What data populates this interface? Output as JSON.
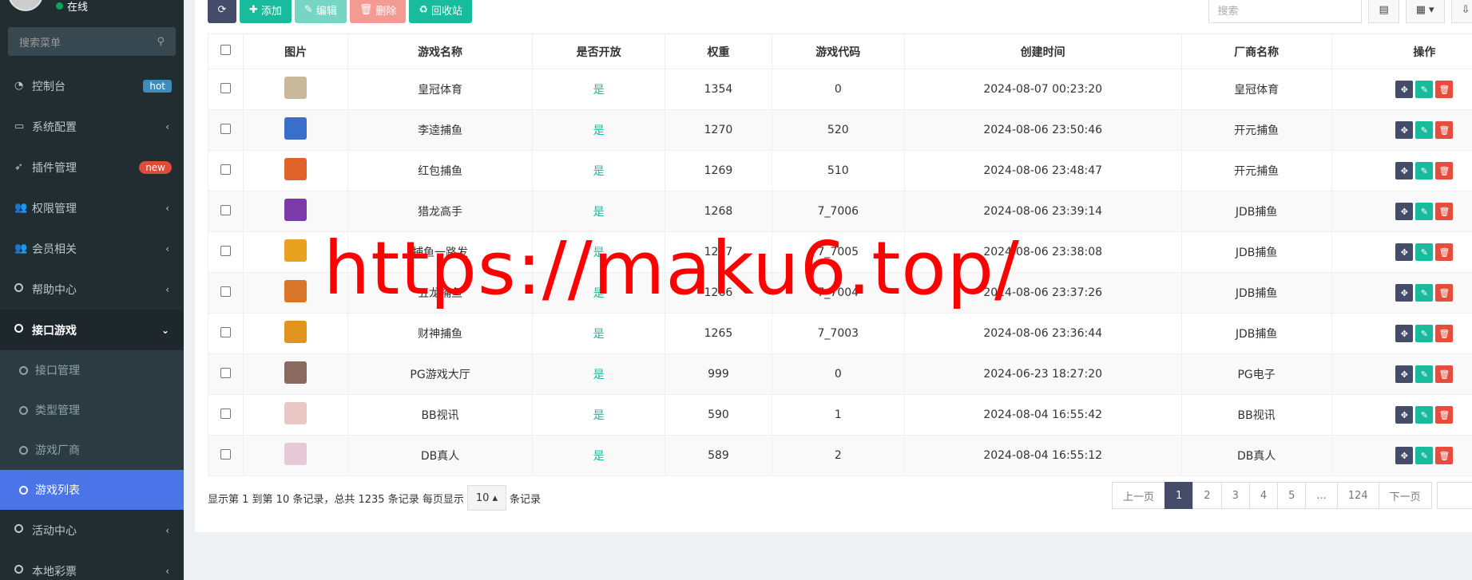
{
  "sidebar": {
    "user_status": "在线",
    "search_placeholder": "搜索菜单",
    "items": [
      {
        "label": "控制台",
        "badge": "hot"
      },
      {
        "label": "系统配置"
      },
      {
        "label": "插件管理",
        "badge": "new"
      },
      {
        "label": "权限管理"
      },
      {
        "label": "会员相关"
      },
      {
        "label": "帮助中心"
      },
      {
        "label": "接口游戏"
      },
      {
        "label": "活动中心"
      },
      {
        "label": "本地彩票"
      }
    ],
    "sub_items": [
      {
        "label": "接口管理"
      },
      {
        "label": "类型管理"
      },
      {
        "label": "游戏厂商"
      },
      {
        "label": "游戏列表"
      }
    ]
  },
  "toolbar": {
    "add": "添加",
    "edit": "编辑",
    "delete": "删除",
    "recycle": "回收站",
    "search_placeholder": "搜索"
  },
  "table": {
    "headers": [
      "图片",
      "游戏名称",
      "是否开放",
      "权重",
      "游戏代码",
      "创建时间",
      "厂商名称",
      "操作"
    ],
    "rows": [
      {
        "name": "皇冠体育",
        "open": "是",
        "weight": "1354",
        "code": "0",
        "created": "2024-08-07 00:23:20",
        "vendor": "皇冠体育",
        "color": "#c9b99a"
      },
      {
        "name": "李逵捕鱼",
        "open": "是",
        "weight": "1270",
        "code": "520",
        "created": "2024-08-06 23:50:46",
        "vendor": "开元捕鱼",
        "color": "#3a6fc9"
      },
      {
        "name": "红包捕鱼",
        "open": "是",
        "weight": "1269",
        "code": "510",
        "created": "2024-08-06 23:48:47",
        "vendor": "开元捕鱼",
        "color": "#e0632c"
      },
      {
        "name": "猎龙高手",
        "open": "是",
        "weight": "1268",
        "code": "7_7006",
        "created": "2024-08-06 23:39:14",
        "vendor": "JDB捕鱼",
        "color": "#7c3aa8"
      },
      {
        "name": "捕鱼一路发",
        "open": "是",
        "weight": "1267",
        "code": "7_7005",
        "created": "2024-08-06 23:38:08",
        "vendor": "JDB捕鱼",
        "color": "#e8a21f"
      },
      {
        "name": "五龙捕鱼",
        "open": "是",
        "weight": "1266",
        "code": "7_7004",
        "created": "2024-08-06 23:37:26",
        "vendor": "JDB捕鱼",
        "color": "#d9762a"
      },
      {
        "name": "财神捕鱼",
        "open": "是",
        "weight": "1265",
        "code": "7_7003",
        "created": "2024-08-06 23:36:44",
        "vendor": "JDB捕鱼",
        "color": "#e2951e"
      },
      {
        "name": "PG游戏大厅",
        "open": "是",
        "weight": "999",
        "code": "0",
        "created": "2024-06-23 18:27:20",
        "vendor": "PG电子",
        "color": "#8a6a5e"
      },
      {
        "name": "BB视讯",
        "open": "是",
        "weight": "590",
        "code": "1",
        "created": "2024-08-04 16:55:42",
        "vendor": "BB视讯",
        "color": "#e9c7c5"
      },
      {
        "name": "DB真人",
        "open": "是",
        "weight": "589",
        "code": "2",
        "created": "2024-08-04 16:55:12",
        "vendor": "DB真人",
        "color": "#e6c8d6"
      }
    ]
  },
  "pager": {
    "info_before": "显示第 1 到第 10 条记录，总共 1235 条记录 每页显示",
    "per_page": "10",
    "info_after": "条记录",
    "prev": "上一页",
    "pages": [
      "1",
      "2",
      "3",
      "4",
      "5",
      "...",
      "124"
    ],
    "next": "下一页"
  },
  "watermark": "https://maku6.top/"
}
